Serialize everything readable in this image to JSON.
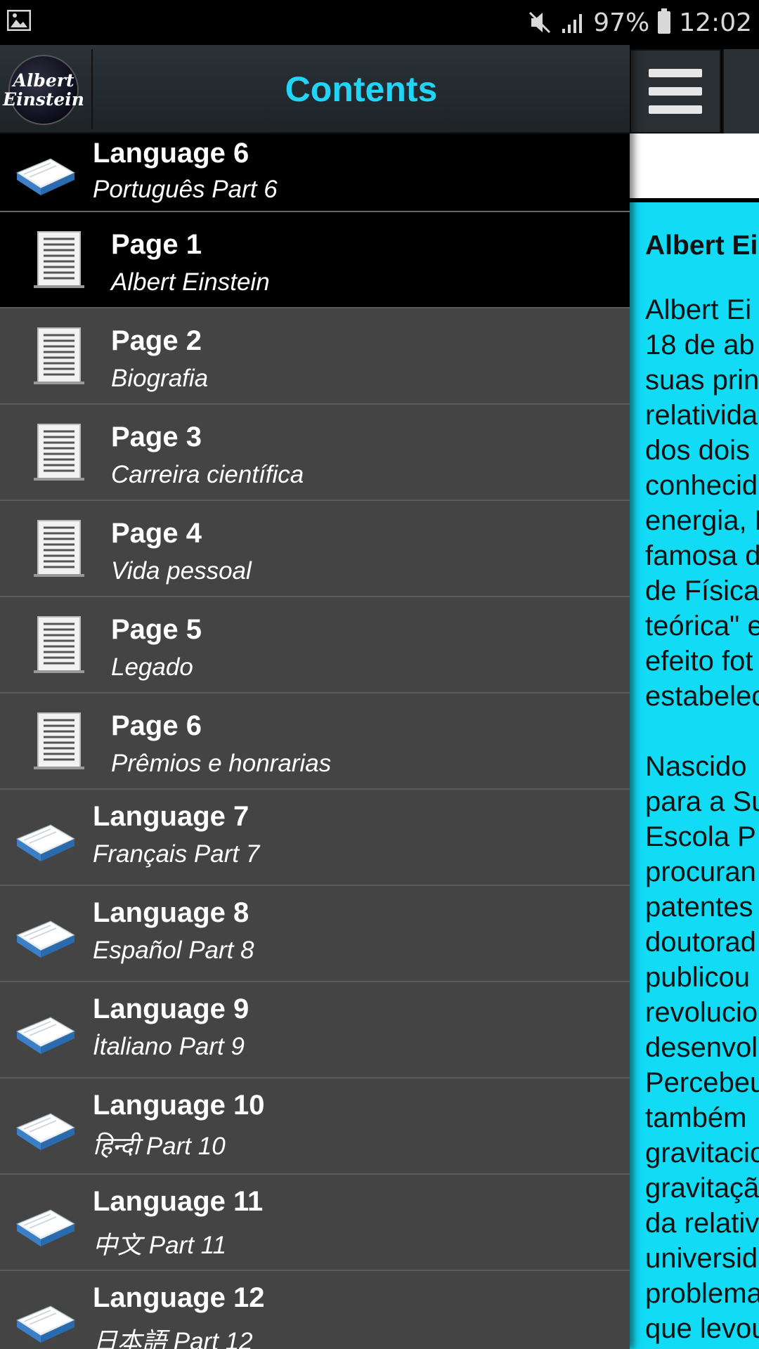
{
  "status_bar": {
    "battery": "97%",
    "time": "12:02",
    "icons": [
      "image-icon",
      "mute-icon",
      "signal-icon",
      "battery-icon"
    ]
  },
  "drawer": {
    "logo_line1": "Albert",
    "logo_line2": "Einstein",
    "title": "Contents",
    "items": [
      {
        "kind": "language",
        "title": "Language 6",
        "subtitle": "Português Part 6",
        "selected": true
      },
      {
        "kind": "page",
        "title": "Page 1",
        "subtitle": "Albert Einstein",
        "selected": true
      },
      {
        "kind": "page",
        "title": "Page 2",
        "subtitle": "Biografia"
      },
      {
        "kind": "page",
        "title": "Page 3",
        "subtitle": "Carreira científica"
      },
      {
        "kind": "page",
        "title": "Page 4",
        "subtitle": "Vida pessoal"
      },
      {
        "kind": "page",
        "title": "Page 5",
        "subtitle": "Legado"
      },
      {
        "kind": "page",
        "title": "Page 6",
        "subtitle": "Prêmios e honrarias"
      },
      {
        "kind": "language",
        "title": "Language 7",
        "subtitle": "Français Part 7"
      },
      {
        "kind": "language",
        "title": "Language 8",
        "subtitle": "Español Part 8"
      },
      {
        "kind": "language",
        "title": "Language 9",
        "subtitle": "İtaliano Part 9"
      },
      {
        "kind": "language",
        "title": "Language 10",
        "subtitle": "हिन्दी Part 10"
      },
      {
        "kind": "language",
        "title": "Language 11",
        "subtitle": "中文 Part 11"
      },
      {
        "kind": "language",
        "title": "Language 12",
        "subtitle": "日本語 Part 12"
      }
    ]
  },
  "article": {
    "title": "Albert Ei",
    "paragraph1": [
      "Albert Ei",
      "18 de ab",
      "suas prin",
      "relativida",
      "dos dois",
      "conhecid",
      "energia, E",
      "famosa d",
      "de Física",
      "teórica\" e",
      "efeito fot",
      "estabelec"
    ],
    "paragraph2": [
      "Nascido",
      "para a Su",
      "Escola P",
      "procuran",
      "patentes",
      "doutorad",
      "publicou",
      "revolucio",
      "desenvol",
      "Percebeu",
      "também",
      "gravitacio",
      "gravitaçã",
      "da relativ",
      "universid",
      "problema",
      "que levou"
    ]
  }
}
